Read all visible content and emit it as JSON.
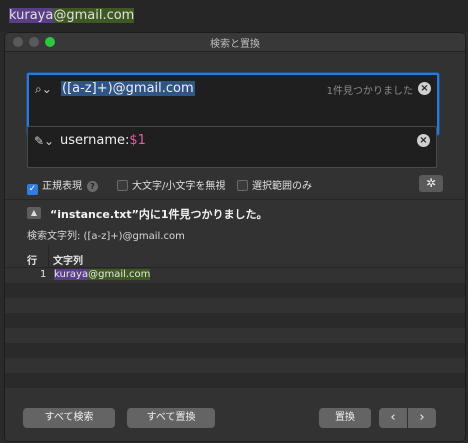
{
  "editor": {
    "line_group": "kuraya",
    "line_rest": "@gmail.com"
  },
  "window": {
    "title": "検索と置換"
  },
  "search": {
    "query": "([a-z]+)@gmail.com",
    "found_text": "1件見つかりました"
  },
  "replace": {
    "prefix": "username:",
    "capture": "$1"
  },
  "options": {
    "regex_label": "正規表現",
    "regex_checked": true,
    "help": "?",
    "ignore_case_label": "大文字/小文字を無視",
    "selection_only_label": "選択範囲のみ"
  },
  "results": {
    "title": "“instance.txt”内に1件見つかりました。",
    "search_string_label": "検索文字列: ([a-z]+)@gmail.com",
    "columns": {
      "line": "行",
      "string": "文字列"
    },
    "rows": [
      {
        "line": "1",
        "group": "kuraya",
        "rest": "@gmail.com"
      }
    ]
  },
  "buttons": {
    "find_all": "すべて検索",
    "replace_all": "すべて置換",
    "replace": "置換",
    "prev": "‹",
    "next": "›"
  }
}
